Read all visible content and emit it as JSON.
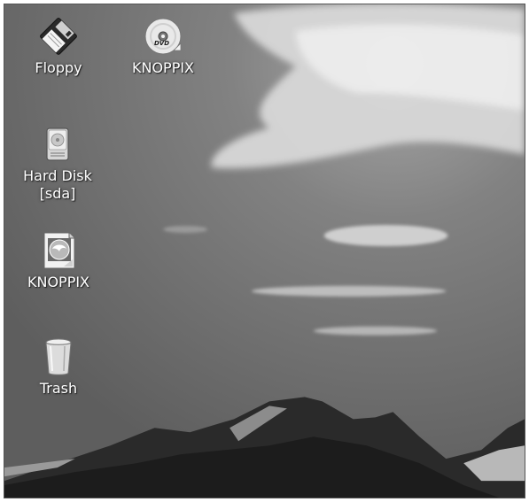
{
  "desktop": {
    "icons": [
      {
        "label": "Floppy",
        "icon": "floppy-disk-icon"
      },
      {
        "label": "KNOPPIX",
        "icon": "dvd-disc-icon"
      },
      {
        "label": "Hard Disk\n[sda]",
        "icon": "hard-disk-icon"
      },
      {
        "label": "KNOPPIX",
        "icon": "knoppix-document-icon"
      },
      {
        "label": "Trash",
        "icon": "trash-icon"
      }
    ]
  }
}
